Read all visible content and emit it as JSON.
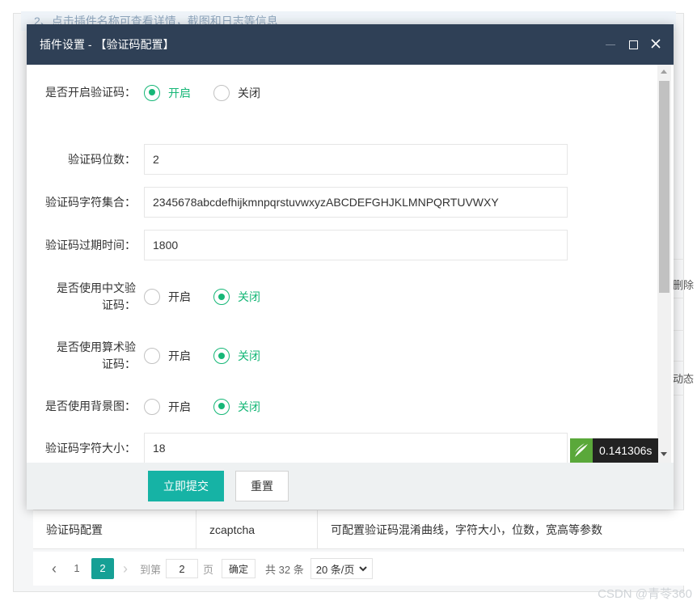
{
  "background": {
    "tip": "2、点击插件名称可查看详情，截图和日志等信息",
    "side_text_1": "删除",
    "side_text_2": "动态",
    "table_row": {
      "name": "验证码配置",
      "code": "zcaptcha",
      "desc": "可配置验证码混淆曲线，字符大小，位数，宽高等参数"
    },
    "pager": {
      "prev": "‹",
      "page1": "1",
      "page2": "2",
      "next": "›",
      "goto_label": "到第",
      "goto_value": "2",
      "page_unit": "页",
      "confirm": "确定",
      "total": "共 32 条",
      "page_size": "20 条/页"
    },
    "watermark": "CSDN @青苓360"
  },
  "modal": {
    "title": "插件设置 - 【验证码配置】",
    "fields": [
      {
        "label": "是否开启验证码：",
        "type": "radio",
        "on_label": "开启",
        "off_label": "关闭",
        "selected": "on"
      },
      {
        "label": "验证码位数：",
        "type": "text",
        "value": "2"
      },
      {
        "label": "验证码字符集合：",
        "type": "text",
        "value": "2345678abcdefhijkmnpqrstuvwxyzABCDEFGHJKLMNPQRTUVWXY"
      },
      {
        "label": "验证码过期时间：",
        "type": "text",
        "value": "1800"
      },
      {
        "label": "是否使用中文验证码：",
        "type": "radio",
        "on_label": "开启",
        "off_label": "关闭",
        "selected": "off"
      },
      {
        "label": "是否使用算术验证码：",
        "type": "radio",
        "on_label": "开启",
        "off_label": "关闭",
        "selected": "off"
      },
      {
        "label": "是否使用背景图：",
        "type": "radio",
        "on_label": "开启",
        "off_label": "关闭",
        "selected": "off"
      },
      {
        "label": "验证码字符大小：",
        "type": "text",
        "value": "18"
      }
    ],
    "submit_label": "立即提交",
    "reset_label": "重置",
    "perf_time": "0.141306s"
  },
  "colors": {
    "header": "#2f4056",
    "accent": "#16b3a5",
    "radio_on": "#16b777",
    "pager_active": "#16a095"
  }
}
